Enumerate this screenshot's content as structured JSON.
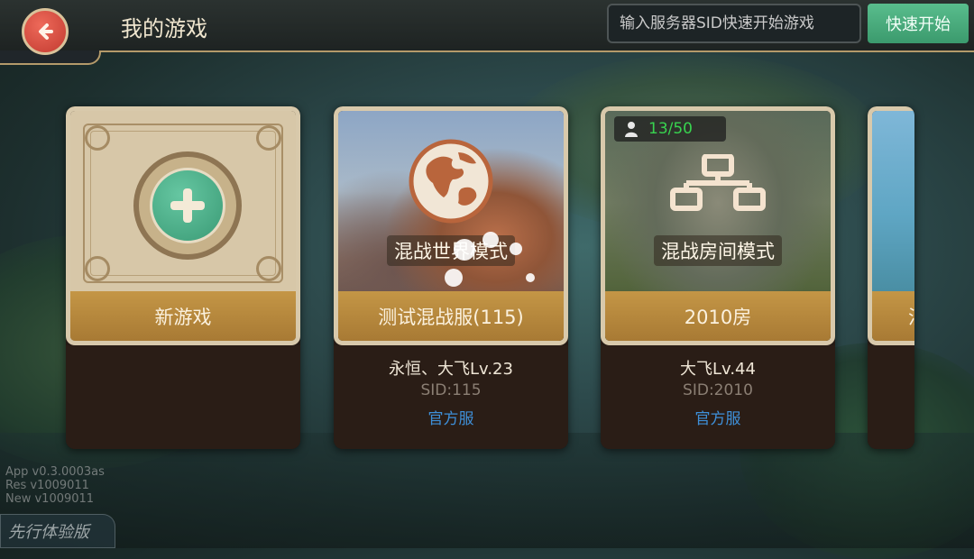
{
  "header": {
    "title": "我的游戏",
    "back_icon": "back-arrow-icon",
    "sid_placeholder": "输入服务器SID快速开始游戏",
    "quick_start_label": "快速开始"
  },
  "colors": {
    "accent_green": "#4aaa7c",
    "back_red": "#d84a3c",
    "link_blue": "#3e8fd8",
    "players_green": "#38d34f"
  },
  "cards": [
    {
      "type": "new",
      "label": "新游戏",
      "icon": "plus-icon"
    },
    {
      "type": "server",
      "mode": "混战世界模式",
      "mode_icon": "globe-icon",
      "label": "测试混战服(115)",
      "owner": "永恒、大飞Lv.23",
      "sid": "SID:115",
      "server_type": "官方服"
    },
    {
      "type": "room",
      "players": "13/50",
      "players_icon": "person-icon",
      "mode": "混战房间模式",
      "mode_icon": "network-icon",
      "label": "2010房",
      "owner": "大飞Lv.44",
      "sid": "SID:2010",
      "server_type": "官方服"
    },
    {
      "type": "partial",
      "label": "混"
    }
  ],
  "version": {
    "app": "App  v0.3.0003as",
    "res": "Res   v1009011",
    "new": "New  v1009011"
  },
  "beta_label": "先行体验版"
}
